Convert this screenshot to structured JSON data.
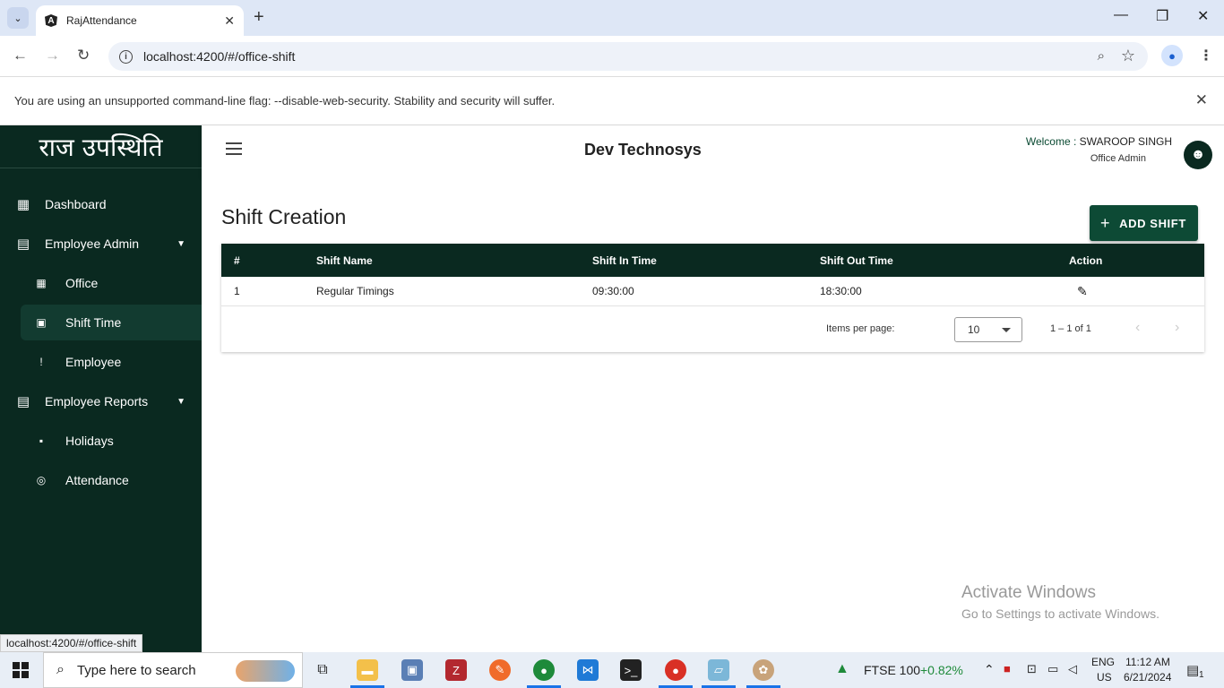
{
  "browser": {
    "tab_title": "RajAttendance",
    "url": "localhost:4200/#/office-shift",
    "infobar_message": "You are using an unsupported command-line flag: --disable-web-security. Stability and security will suffer.",
    "status_link": "localhost:4200/#/office-shift"
  },
  "sidebar": {
    "logo": "राज उपस्थिति",
    "items": [
      {
        "label": "Dashboard",
        "icon": "dashboard-icon"
      },
      {
        "label": "Employee Admin",
        "icon": "library-books-icon"
      },
      {
        "label": "Office",
        "icon": "dashboard-icon"
      },
      {
        "label": "Shift Time",
        "icon": "calendar-icon"
      },
      {
        "label": "Employee",
        "icon": "person-icon"
      },
      {
        "label": "Employee Reports",
        "icon": "library-books-icon"
      },
      {
        "label": "Holidays",
        "icon": "briefcase-icon"
      },
      {
        "label": "Attendance",
        "icon": "fingerprint-icon"
      }
    ]
  },
  "header": {
    "company": "Dev Technosys",
    "welcome_prefix": "Welcome :",
    "user_name": "SWAROOP SINGH",
    "role": "Office Admin"
  },
  "main": {
    "title": "Shift Creation",
    "add_button": "ADD SHIFT",
    "columns": [
      "#",
      "Shift Name",
      "Shift In Time",
      "Shift Out Time",
      "Action"
    ],
    "rows": [
      {
        "index": "1",
        "name": "Regular Timings",
        "in_time": "09:30:00",
        "out_time": "18:30:00"
      }
    ],
    "paginator": {
      "items_per_page_label": "Items per page:",
      "page_size": "10",
      "range": "1 – 1 of 1"
    }
  },
  "watermark": {
    "line1": "Activate Windows",
    "line2": "Go to Settings to activate Windows."
  },
  "taskbar": {
    "search_placeholder": "Type here to search",
    "ticker_name": "FTSE 100",
    "ticker_change": "+0.82%",
    "lang1": "ENG",
    "lang2": "US",
    "time": "11:12 AM",
    "date": "6/21/2024",
    "notification_count": "1"
  },
  "colors": {
    "sidebar_bg": "#0a2920",
    "accent": "#0d4a35",
    "ticker_positive": "#1e8a3a"
  }
}
